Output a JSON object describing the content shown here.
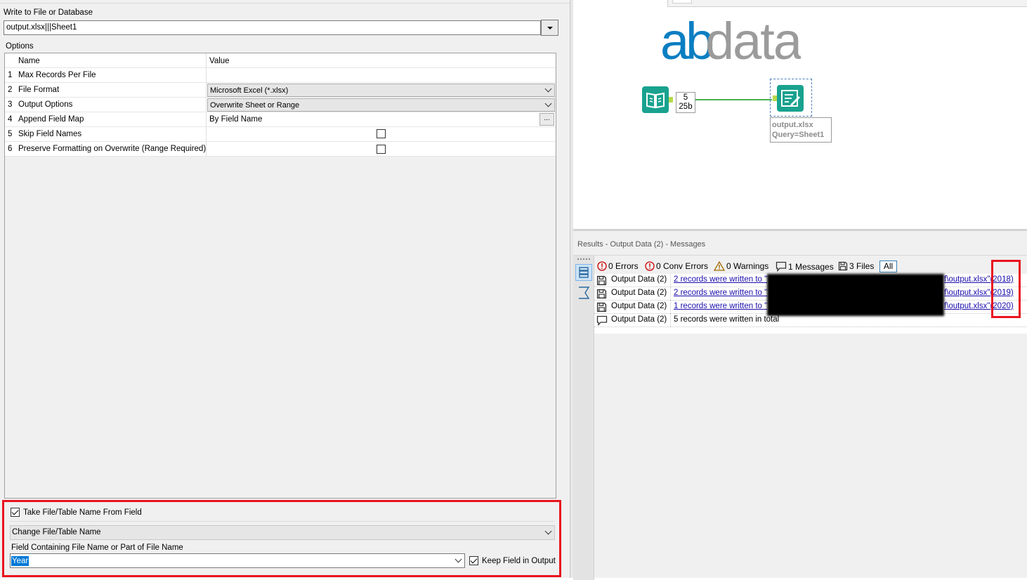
{
  "config": {
    "write_label": "Write to File or Database",
    "destination": "output.xlsx|||Sheet1",
    "options_label": "Options",
    "grid": {
      "headers": [
        "Name",
        "Value"
      ],
      "rows": [
        {
          "num": "1",
          "name": "Max Records Per File",
          "value": ""
        },
        {
          "num": "2",
          "name": "File Format",
          "value": "Microsoft Excel (*.xlsx)"
        },
        {
          "num": "3",
          "name": "Output Options",
          "value": "Overwrite Sheet or Range"
        },
        {
          "num": "4",
          "name": "Append Field Map",
          "value": "By Field Name",
          "button": "..."
        },
        {
          "num": "5",
          "name": "Skip Field Names",
          "checked": false
        },
        {
          "num": "6",
          "name": "Preserve Formatting on Overwrite (Range Required)",
          "checked": false
        }
      ]
    },
    "take_name": {
      "label": "Take File/Table Name From Field",
      "checked": true
    },
    "change_mode": "Change File/Table Name",
    "field_label": "Field Containing File Name or Part of File Name",
    "field_value": "Year",
    "keep_field": {
      "label": "Keep Field in Output",
      "checked": true
    }
  },
  "canvas": {
    "logo_ab": "ab",
    "logo_data": "data",
    "record_count": "5",
    "record_size": "25b",
    "annotation_line1": "output.xlsx",
    "annotation_line2": "Query=Sheet1"
  },
  "results": {
    "title": "Results - Output Data (2) - Messages",
    "filters": {
      "errors": "0 Errors",
      "conv_errors": "0 Conv Errors",
      "warnings": "0 Warnings",
      "messages": "1 Messages",
      "files": "3 Files",
      "all": "All"
    },
    "rows": [
      {
        "tool": "Output Data (2)",
        "text": "2 records were written to \"",
        "path": "f\\output.xlsx\"",
        "suffix": "(2018)"
      },
      {
        "tool": "Output Data (2)",
        "text": "2 records were written to \"",
        "path": "f\\output.xlsx\"",
        "suffix": "(2019)"
      },
      {
        "tool": "Output Data (2)",
        "text": "1 records were written to \"",
        "path": "f\\output.xlsx\"",
        "suffix": "(2020)"
      },
      {
        "tool": "Output Data (2)",
        "text": "5 records were written in total"
      }
    ]
  },
  "colors": {
    "accent_red": "#e8141e",
    "tool_teal": "#19a28f",
    "logo_blue": "#0a7ec2",
    "logo_grey": "#9b9b9b",
    "link_blue": "#1a0dab",
    "selection_blue": "#0078d7"
  },
  "icons": [
    "dropdown-arrow-icon",
    "browse-icon",
    "checkbox-icon",
    "input-data-tool-icon",
    "output-data-tool-icon",
    "error-icon",
    "warning-icon",
    "message-icon",
    "file-icon",
    "results-grid-icon",
    "results-sigma-icon"
  ]
}
